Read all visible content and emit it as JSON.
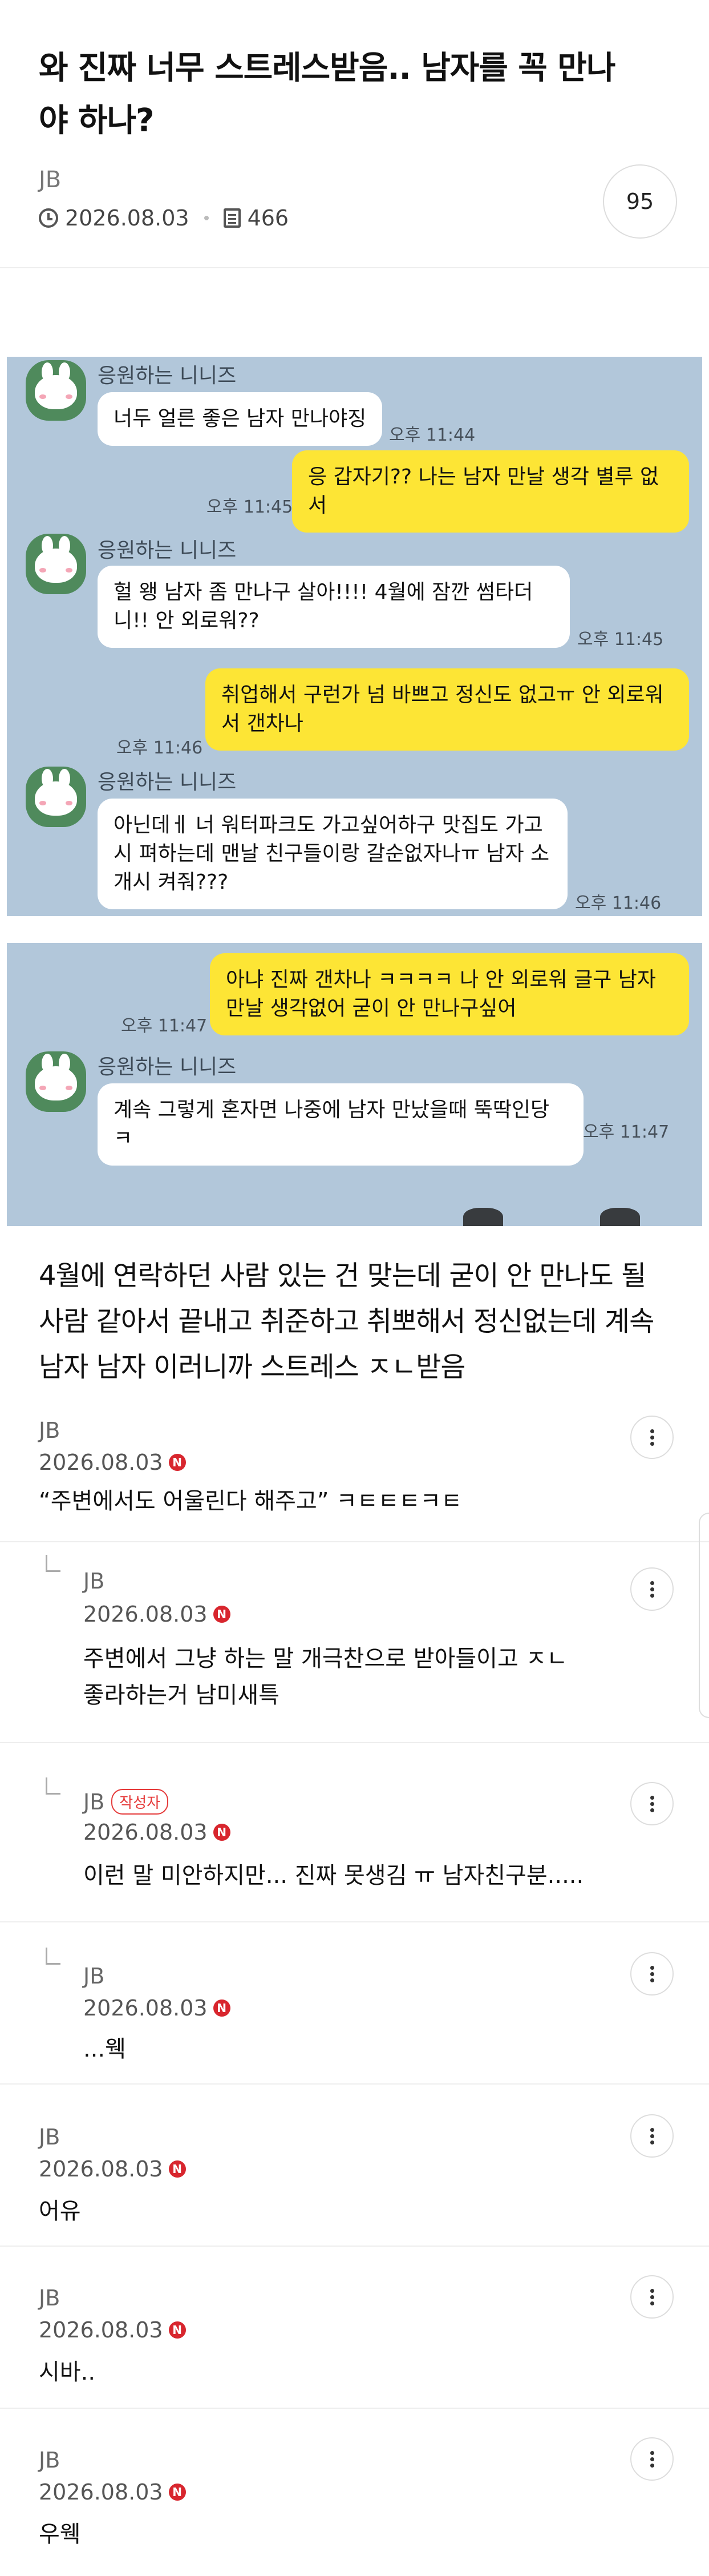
{
  "post": {
    "title": "와 진짜 너무 스트레스받음.. 남자를 꼭 만나야 하나?",
    "author": "JB",
    "date": "2026.08.03",
    "views": "466",
    "comment_count": "95",
    "body": "4월에 연락하던 사람 있는 건 맞는데 굳이 안 만나도 될 사람 같아서 끝내고 취준하고 취뽀해서 정신없는데 계속 남자 남자 이러니까 스트레스 ㅈㄴ받음"
  },
  "chat": {
    "sender": "응원하는 니니즈",
    "messages": [
      {
        "side": "in",
        "text": "너두 얼른 좋은 남자 만나야징",
        "time": "오후 11:44",
        "show_sender": true
      },
      {
        "side": "out",
        "text": "응 갑자기?? 나는 남자 만날 생각 별루 없서",
        "time": "오후 11:45"
      },
      {
        "side": "in",
        "text": "헐 왱 남자 좀 만나구 살아!!!! 4월에 잠깐 썸타더니!! 안 외로워??",
        "time": "오후 11:45",
        "show_sender": true
      },
      {
        "side": "out",
        "text": "취업해서 구런가 넘 바쁘고 정신도 없고ㅠ 안 외로워서 갠차나",
        "time": "오후 11:46"
      },
      {
        "side": "in",
        "text": "아닌데ㅔ 너 워터파크도 가고싶어하구 맛집도 가고시 펴하는데 맨날 친구들이랑 갈순없자나ㅠ 남자 소개시 켜줘???",
        "time": "오후 11:46",
        "show_sender": true
      },
      {
        "side": "out",
        "text": "아냐 진짜 갠차나 ㅋㅋㅋㅋ 나 안 외로워 글구 남자 만날 생각없어 굳이 안 만나구싶어",
        "time": "오후 11:47"
      },
      {
        "side": "in",
        "text": "계속 그렇게 혼자면 나중에 남자 만났을때 뚝딱인당 ㅋ",
        "time": "오후 11:47",
        "show_sender": true
      }
    ]
  },
  "comments": [
    {
      "author": "JB",
      "date": "2026.08.03",
      "text": "“주변에서도 어울린다 해주고” ㅋㅌㅌㅌㅋㅌ",
      "reply": false,
      "writer": false
    },
    {
      "author": "JB",
      "date": "2026.08.03",
      "text": "주변에서 그냥 하는 말 개극찬으로 받아들이고 ㅈㄴ 좋라하는거 남미새특",
      "reply": true,
      "writer": false
    },
    {
      "author": "JB",
      "date": "2026.08.03",
      "text": "이런 말 미안하지만... 진짜 못생김 ㅠ 남자친구분.....",
      "reply": true,
      "writer": true
    },
    {
      "author": "JB",
      "date": "2026.08.03",
      "text": "...웩",
      "reply": true,
      "writer": false
    },
    {
      "author": "JB",
      "date": "2026.08.03",
      "text": "어유",
      "reply": false,
      "writer": false
    },
    {
      "author": "JB",
      "date": "2026.08.03",
      "text": "시바..",
      "reply": false,
      "writer": false
    },
    {
      "author": "JB",
      "date": "2026.08.03",
      "text": "우웩",
      "reply": false,
      "writer": false
    }
  ],
  "labels": {
    "writer_badge": "작성자",
    "new_badge": "N"
  },
  "icons": {
    "time": "clock-icon",
    "views": "document-icon",
    "more": "more-vertical-icon",
    "reply": "reply-arrow-icon"
  },
  "colors": {
    "chat_bg": "#b2c7da",
    "out_bubble": "#fde535",
    "in_bubble": "#ffffff",
    "badge_red": "#d8262e"
  }
}
